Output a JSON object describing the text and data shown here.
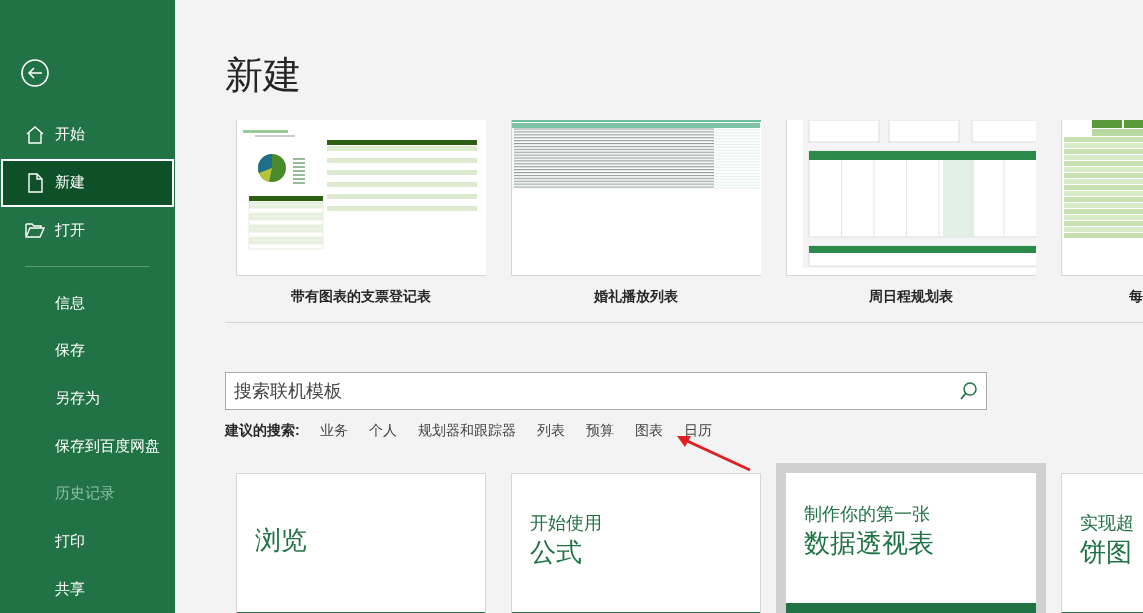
{
  "sidebar": {
    "top_items": [
      {
        "label": "开始",
        "kind": "home",
        "selected": false,
        "disabled": false
      },
      {
        "label": "新建",
        "kind": "new",
        "selected": true,
        "disabled": false
      },
      {
        "label": "打开",
        "kind": "open",
        "selected": false,
        "disabled": false
      }
    ],
    "bottom_items": [
      {
        "label": "信息",
        "selected": false,
        "disabled": false
      },
      {
        "label": "保存",
        "selected": false,
        "disabled": false
      },
      {
        "label": "另存为",
        "selected": false,
        "disabled": false
      },
      {
        "label": "保存到百度网盘",
        "selected": false,
        "disabled": false
      },
      {
        "label": "历史记录",
        "selected": false,
        "disabled": true
      },
      {
        "label": "打印",
        "selected": false,
        "disabled": false
      },
      {
        "label": "共享",
        "selected": false,
        "disabled": false
      }
    ]
  },
  "title": "新建",
  "templates": [
    {
      "label": "带有图表的支票登记表",
      "kind": "register"
    },
    {
      "label": "婚礼播放列表",
      "kind": "list"
    },
    {
      "label": "周日程规划表",
      "kind": "calendar"
    },
    {
      "label": "每",
      "kind": "grid"
    }
  ],
  "search": {
    "placeholder": "搜索联机模板"
  },
  "suggested": {
    "label": "建议的搜索:",
    "terms": [
      "业务",
      "个人",
      "规划器和跟踪器",
      "列表",
      "预算",
      "图表",
      "日历"
    ]
  },
  "tours": [
    {
      "lines": [
        "浏览"
      ],
      "selected": false
    },
    {
      "lines": [
        "开始使用",
        "公式"
      ],
      "selected": false
    },
    {
      "lines": [
        "制作你的第一张",
        "数据透视表"
      ],
      "selected": true
    },
    {
      "lines": [
        "实现超",
        "饼图"
      ],
      "selected": false
    }
  ]
}
